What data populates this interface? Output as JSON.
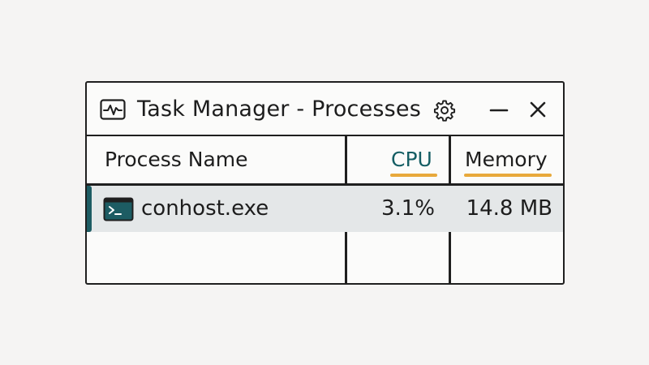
{
  "window": {
    "title": "Task Manager - Processes",
    "icons": {
      "app": "activity-chart-icon",
      "settings": "gear-icon",
      "minimize": "minimize-icon",
      "close": "close-icon"
    }
  },
  "table": {
    "columns": {
      "name": "Process Name",
      "cpu": "CPU",
      "memory": "Memory"
    },
    "rows": [
      {
        "name": "conhost.exe",
        "icon": "terminal-icon",
        "cpu": "3.1%",
        "memory": "14.8 MB"
      }
    ]
  },
  "colors": {
    "accent_teal": "#155e64",
    "sort_underline": "#e8a93b",
    "selected_row": "#e4e7e8",
    "border": "#1f1f1f"
  }
}
